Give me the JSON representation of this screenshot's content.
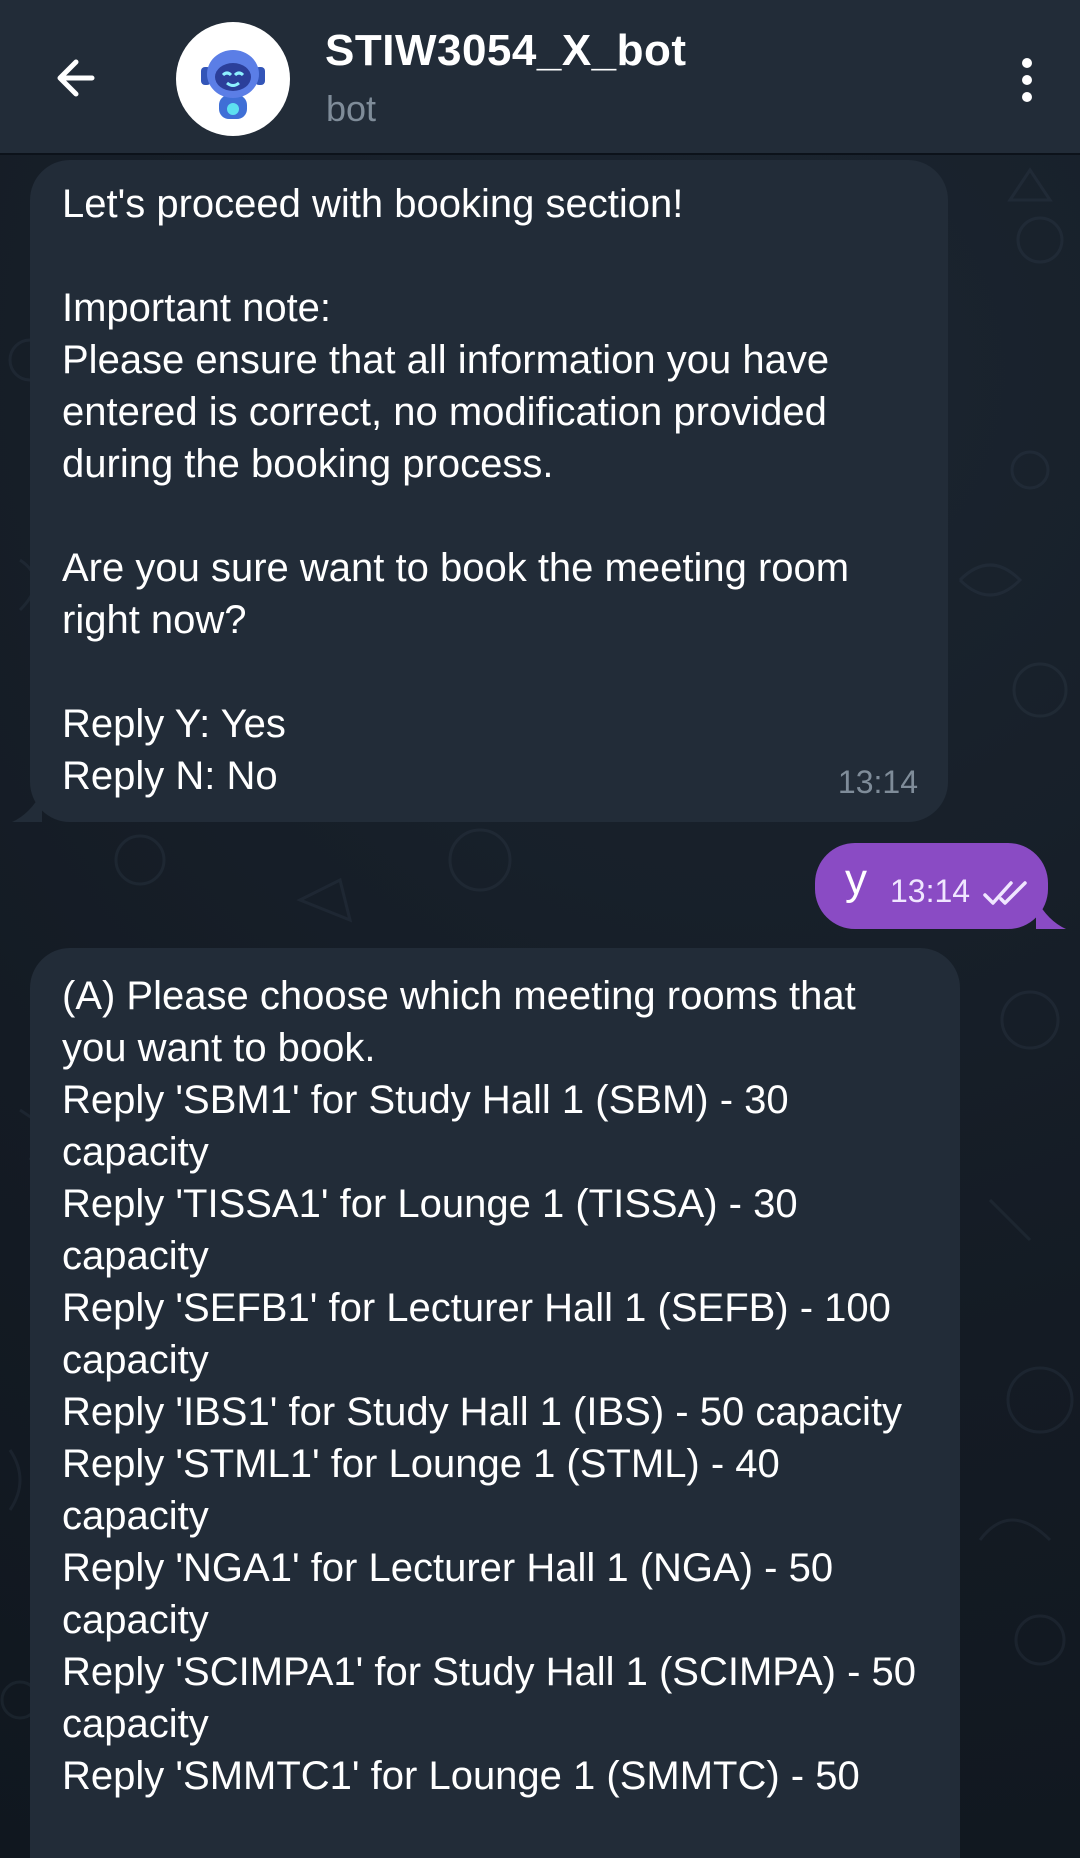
{
  "header": {
    "title": "STIW3054_X_bot",
    "subtitle": "bot"
  },
  "messages": [
    {
      "direction": "incoming",
      "text": "Let's proceed with booking section!\n\nImportant note:\nPlease ensure that all information you have entered is correct, no modification provided during the booking process.\n\nAre you sure want to book the meeting room right now?\n\nReply Y: Yes\nReply N: No",
      "time": "13:14"
    },
    {
      "direction": "outgoing",
      "text": "y",
      "time": "13:14",
      "status": "read-double-check-icon"
    },
    {
      "direction": "incoming",
      "text": "(A) Please choose which meeting rooms that you want to book.\nReply 'SBM1' for Study Hall 1 (SBM) - 30 capacity\nReply 'TISSA1' for Lounge 1 (TISSA) - 30 capacity\nReply 'SEFB1' for Lecturer Hall 1 (SEFB) - 100 capacity\nReply 'IBS1' for Study Hall 1 (IBS) - 50 capacity\nReply 'STML1' for Lounge 1 (STML) - 40 capacity\nReply 'NGA1' for Lecturer Hall 1 (NGA) - 50 capacity\nReply 'SCIMPA1' for Study Hall 1 (SCIMPA) - 50 capacity\nReply 'SMMTC1' for Lounge 1 (SMMTC) - 50"
    }
  ],
  "colors": {
    "header_bg": "#222c38",
    "incoming_bubble": "#222c38",
    "outgoing_bubble": "#8a4bc4",
    "background": "#151d27",
    "timestamp": "#7f8c99"
  },
  "icons": {
    "back": "arrow-left-icon",
    "menu": "more-vertical-icon",
    "avatar": "robot-avatar-icon"
  }
}
